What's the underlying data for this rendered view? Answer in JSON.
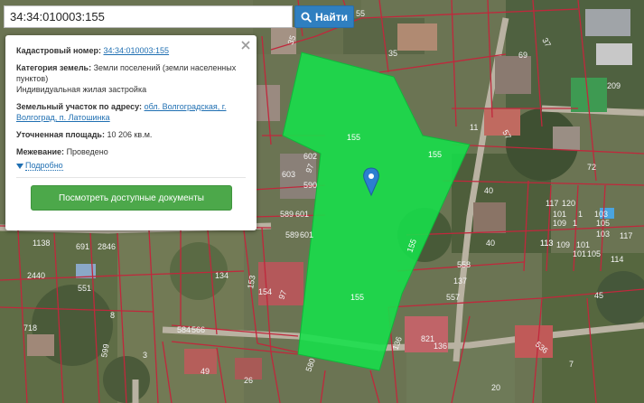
{
  "search": {
    "value": "34:34:010003:155",
    "button_label": "Найти"
  },
  "popup": {
    "cadastral_label": "Кадастровый номер:",
    "cadastral_value": "34:34:010003:155",
    "category_label": "Категория земель:",
    "category_value": "Земли поселений (земли населенных пунктов)",
    "use_value": "Индивидуальная жилая застройка",
    "address_label": "Земельный участок по адресу:",
    "address_value": "обл. Волгоградская, г. Волгоград, п. Латошинка",
    "area_label": "Уточненная площадь:",
    "area_value": "10 206 кв.м.",
    "survey_label": "Межевание:",
    "survey_value": "Проведено",
    "more_label": "Подробно",
    "docs_button": "Посмотреть доступные документы"
  },
  "colors": {
    "highlight_parcel": "#16e04a",
    "boundary_lines": "#c0283c",
    "search_button": "#2f7fc0",
    "docs_button": "#4ca84a",
    "marker": "#2c7fd0"
  },
  "map": {
    "highlighted_parcel_labels": [
      "155",
      "155",
      "155",
      "155"
    ],
    "parcel_labels": [
      "55",
      "35",
      "35",
      "69",
      "209",
      "37",
      "11",
      "57",
      "72",
      "40",
      "40",
      "117",
      "120",
      "103",
      "101",
      "109",
      "105",
      "113",
      "1",
      "1",
      "113",
      "109",
      "101",
      "103",
      "117",
      "101",
      "105",
      "114",
      "558",
      "137",
      "557",
      "45",
      "602",
      "97",
      "603",
      "590",
      "589",
      "601",
      "589",
      "601",
      "1138",
      "691",
      "2846",
      "2440",
      "551",
      "134",
      "153",
      "154",
      "97",
      "718",
      "8",
      "599",
      "3",
      "584",
      "566",
      "49",
      "26",
      "580",
      "136",
      "821",
      "136",
      "536",
      "20",
      "7"
    ]
  },
  "icons": [
    "search-icon",
    "close-icon",
    "triangle-down-icon",
    "map-marker-icon"
  ]
}
